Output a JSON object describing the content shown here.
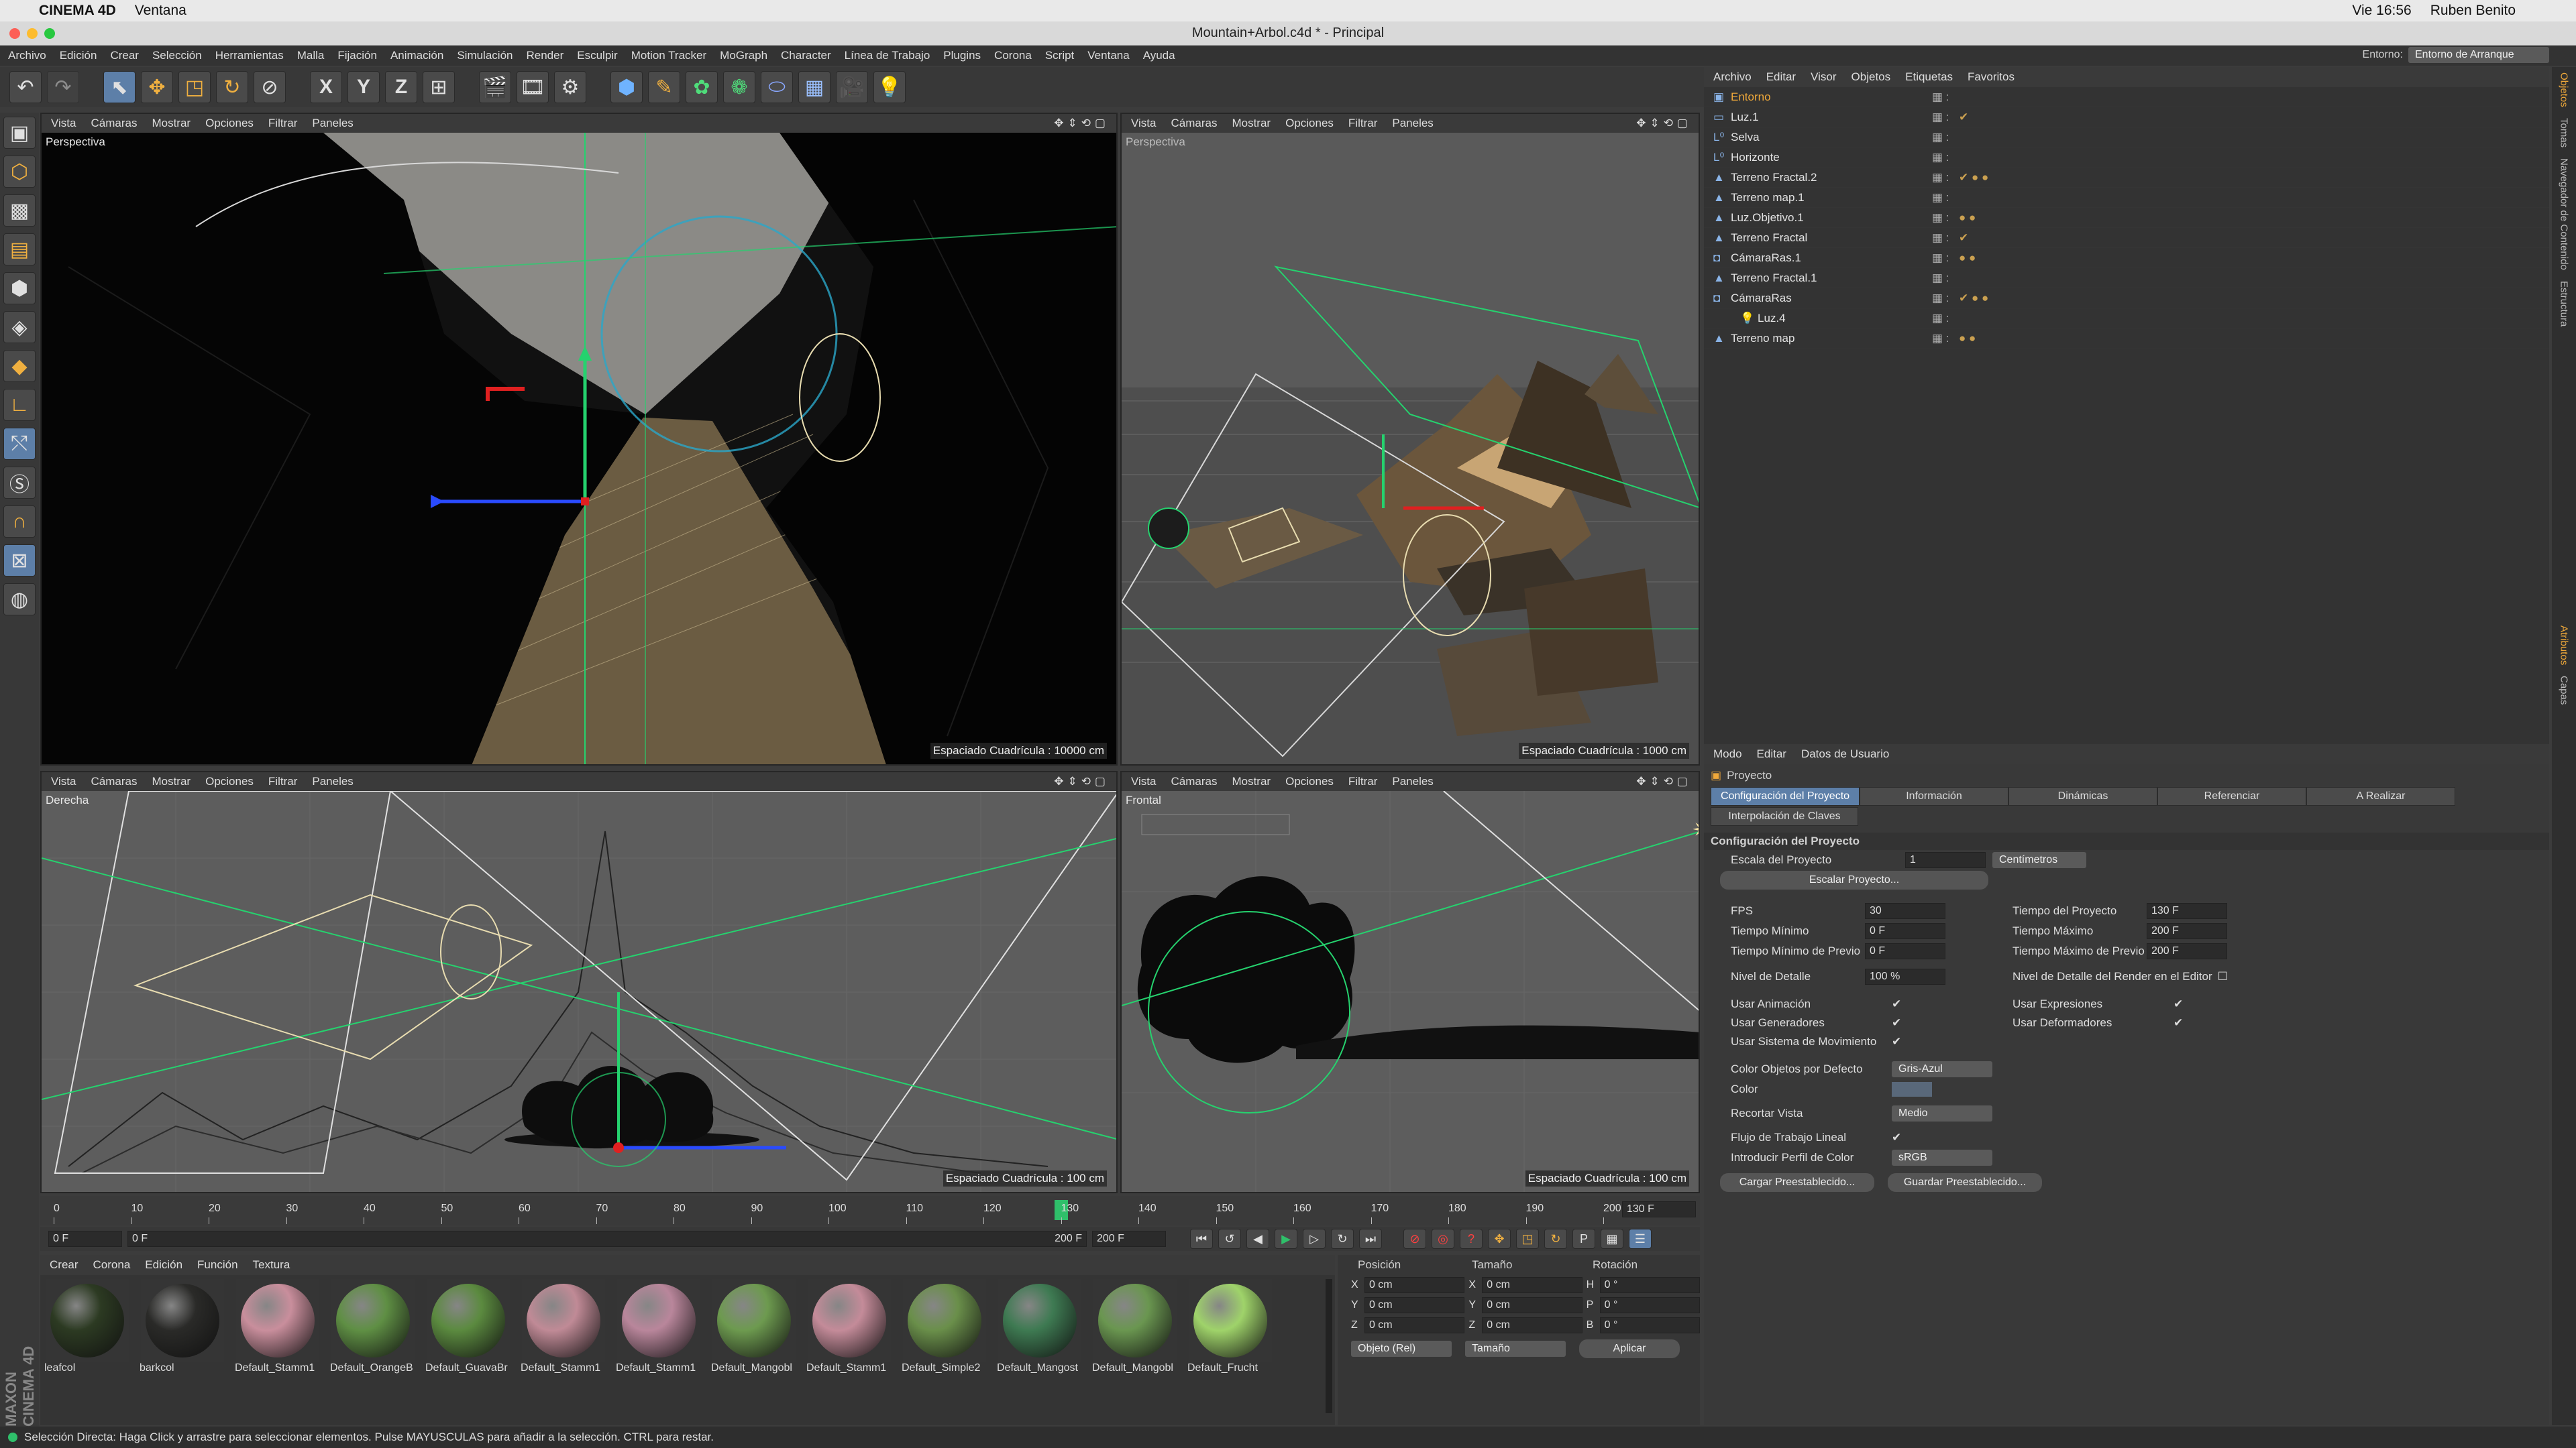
{
  "mac_menu": {
    "app": "CINEMA 4D",
    "items": [
      "Ventana"
    ],
    "time": "Vie 16:56",
    "user": "Ruben Benito"
  },
  "window_title": "Mountain+Arbol.c4d * - Principal",
  "menubar": [
    "Archivo",
    "Edición",
    "Crear",
    "Selección",
    "Herramientas",
    "Malla",
    "Fijación",
    "Animación",
    "Simulación",
    "Render",
    "Esculpir",
    "Motion Tracker",
    "MoGraph",
    "Character",
    "Línea de Trabajo",
    "Plugins",
    "Corona",
    "Script",
    "Ventana",
    "Ayuda"
  ],
  "layout": {
    "label": "Entorno:",
    "value": "Entorno de Arranque"
  },
  "viewport_menu": [
    "Vista",
    "Cámaras",
    "Mostrar",
    "Opciones",
    "Filtrar",
    "Paneles"
  ],
  "viewports": [
    {
      "name": "Perspectiva",
      "grid": "Espaciado Cuadrícula : 10000 cm"
    },
    {
      "name": "Perspectiva",
      "grid": "Espaciado Cuadrícula : 1000 cm"
    },
    {
      "name": "Derecha",
      "grid": "Espaciado Cuadrícula : 100 cm"
    },
    {
      "name": "Frontal",
      "grid": "Espaciado Cuadrícula : 100 cm"
    }
  ],
  "object_manager": {
    "menu": [
      "Archivo",
      "Editar",
      "Visor",
      "Objetos",
      "Etiquetas",
      "Favoritos"
    ],
    "objects": [
      "Entorno",
      "Luz.1",
      "Selva",
      "Horizonte",
      "Terreno Fractal.2",
      "Terreno map.1",
      "Luz.Objetivo.1",
      "Terreno Fractal",
      "CámaraRas.1",
      "Terreno Fractal.1",
      "CámaraRas",
      "Luz.4",
      "Terreno map"
    ]
  },
  "attr_manager": {
    "menu": [
      "Modo",
      "Editar",
      "Datos de Usuario"
    ],
    "object": "Proyecto",
    "tabs": [
      "Configuración del Proyecto",
      "Información",
      "Dinámicas",
      "Referenciar",
      "A Realizar"
    ],
    "tab2": "Interpolación de Claves",
    "section": "Configuración del Proyecto",
    "scale_label": "Escala del Proyecto",
    "scale_value": "1",
    "scale_unit": "Centímetros",
    "scale_button": "Escalar Proyecto...",
    "left": [
      {
        "label": "FPS",
        "value": "30"
      },
      {
        "label": "Tiempo Mínimo",
        "value": "0 F"
      },
      {
        "label": "Tiempo Mínimo de Previo",
        "value": "0 F"
      }
    ],
    "right": [
      {
        "label": "Tiempo del Proyecto",
        "value": "130 F"
      },
      {
        "label": "Tiempo Máximo",
        "value": "200 F"
      },
      {
        "label": "Tiempo Máximo de Previo",
        "value": "200 F"
      }
    ],
    "lod_label": "Nivel de Detalle",
    "lod_value": "100 %",
    "lod_render": "Nivel de Detalle del Render en el Editor",
    "checks_left": [
      "Usar Animación",
      "Usar Generadores",
      "Usar Sistema de Movimiento"
    ],
    "checks_right": [
      "Usar Expresiones",
      "Usar Deformadores"
    ],
    "color_default_label": "Color Objetos por Defecto",
    "color_default": "Gris-Azul",
    "color_label": "Color",
    "clip_label": "Recortar Vista",
    "clip_value": "Medio",
    "linear_label": "Flujo de Trabajo Lineal",
    "profile_label": "Introducir Perfil de Color",
    "profile_value": "sRGB",
    "load_preset": "Cargar Preestablecido...",
    "save_preset": "Guardar Preestablecido..."
  },
  "timeline": {
    "ticks": [
      "0",
      "10",
      "20",
      "30",
      "40",
      "50",
      "60",
      "70",
      "80",
      "90",
      "100",
      "110",
      "120",
      "130",
      "140",
      "150",
      "160",
      "170",
      "180",
      "190",
      "200"
    ],
    "current": "130",
    "end_field": "130 F",
    "start": "0 F",
    "range_start": "0 F",
    "range_end": "200 F",
    "max": "200 F"
  },
  "material_manager": {
    "menu": [
      "Crear",
      "Corona",
      "Edición",
      "Función",
      "Textura"
    ],
    "materials": [
      {
        "name": "leafcol",
        "color": "#2c3a22"
      },
      {
        "name": "barkcol",
        "color": "#2a2a28"
      },
      {
        "name": "Default_Stamm1",
        "color": "#c98e9c"
      },
      {
        "name": "Default_OrangeB",
        "color": "#5f8f44"
      },
      {
        "name": "Default_GuavaBr",
        "color": "#5b8a3f"
      },
      {
        "name": "Default_Stamm1",
        "color": "#c08a96"
      },
      {
        "name": "Default_Stamm1",
        "color": "#b9869b"
      },
      {
        "name": "Default_Mangobl",
        "color": "#6d9a4f"
      },
      {
        "name": "Default_Stamm1",
        "color": "#c48b99"
      },
      {
        "name": "Default_Simple2",
        "color": "#6a8f4a"
      },
      {
        "name": "Default_Mangost",
        "color": "#3e7a52"
      },
      {
        "name": "Default_Mangobl",
        "color": "#6a9650"
      },
      {
        "name": "Default_Frucht",
        "color": "#9fd36a"
      }
    ]
  },
  "coords": {
    "headers": [
      "Posición",
      "Tamaño",
      "Rotación"
    ],
    "rows": [
      {
        "a": "X",
        "p": "0 cm",
        "b": "X",
        "s": "0 cm",
        "c": "H",
        "r": "0 °"
      },
      {
        "a": "Y",
        "p": "0 cm",
        "b": "Y",
        "s": "0 cm",
        "c": "P",
        "r": "0 °"
      },
      {
        "a": "Z",
        "p": "0 cm",
        "b": "Z",
        "s": "0 cm",
        "c": "B",
        "r": "0 °"
      }
    ],
    "mode": "Objeto (Rel)",
    "size_mode": "Tamaño",
    "apply": "Aplicar"
  },
  "right_tabs_top": [
    "Objetos",
    "Tomas",
    "Navegador de Contenido",
    "Estructura"
  ],
  "right_tabs_bottom": [
    "Atributos",
    "Capas"
  ],
  "brand": "MAXON CINEMA 4D",
  "status": "Selección Directa: Haga Click y arrastre para seleccionar elementos. Pulse MAYUSCULAS para añadir a la selección. CTRL para restar."
}
